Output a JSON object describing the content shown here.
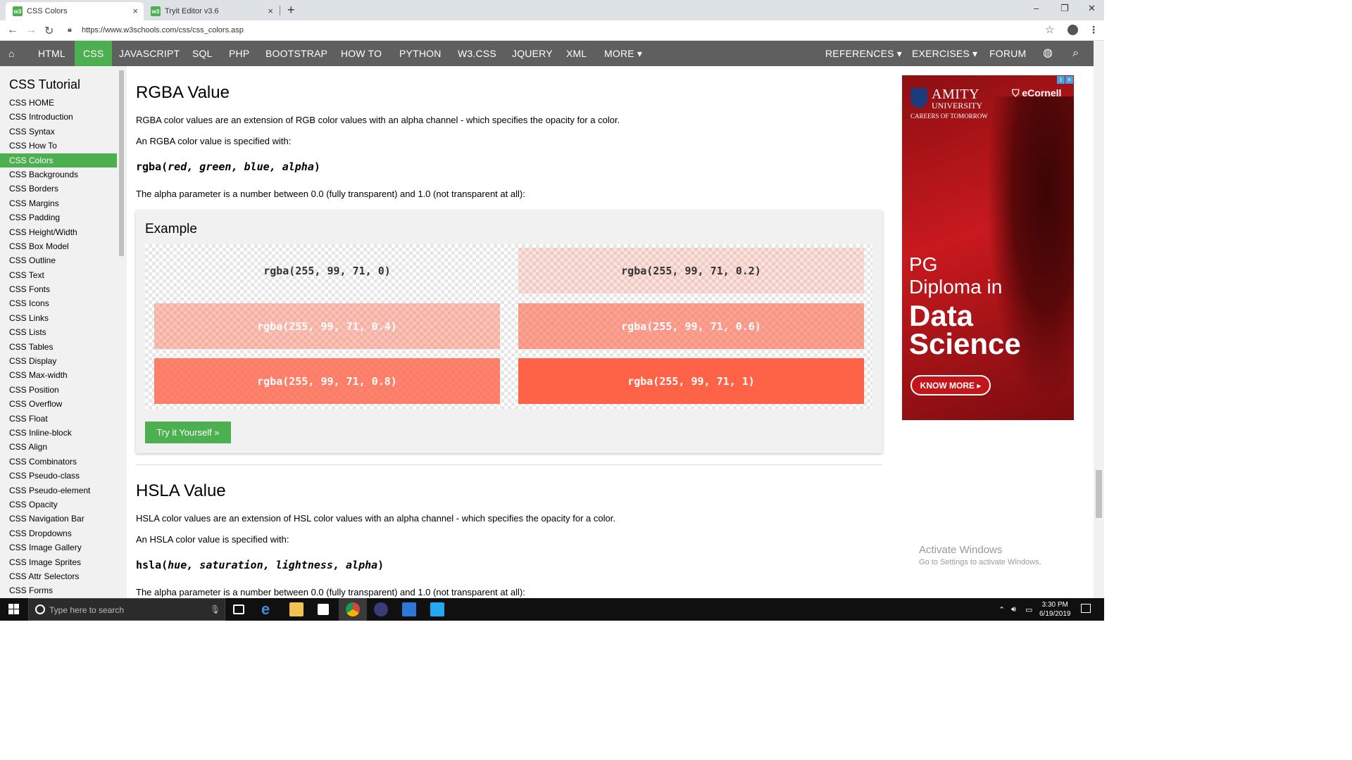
{
  "browser": {
    "tabs": [
      {
        "title": "CSS Colors",
        "active": true
      },
      {
        "title": "Tryit Editor v3.6",
        "active": false
      }
    ],
    "new_tab": "+",
    "url": "https://www.w3schools.com/css/css_colors.asp",
    "window_controls": {
      "minimize": "–",
      "maximize": "❐",
      "close": "✕"
    }
  },
  "topnav": {
    "items": [
      "HTML",
      "CSS",
      "JAVASCRIPT",
      "SQL",
      "PHP",
      "BOOTSTRAP",
      "HOW TO",
      "PYTHON",
      "W3.CSS",
      "JQUERY",
      "XML",
      "MORE ▾"
    ],
    "active": "CSS",
    "right_items": [
      "REFERENCES ▾",
      "EXERCISES ▾",
      "FORUM"
    ]
  },
  "sidebar": {
    "title": "CSS Tutorial",
    "items": [
      "CSS HOME",
      "CSS Introduction",
      "CSS Syntax",
      "CSS How To",
      "CSS Colors",
      "CSS Backgrounds",
      "CSS Borders",
      "CSS Margins",
      "CSS Padding",
      "CSS Height/Width",
      "CSS Box Model",
      "CSS Outline",
      "CSS Text",
      "CSS Fonts",
      "CSS Icons",
      "CSS Links",
      "CSS Lists",
      "CSS Tables",
      "CSS Display",
      "CSS Max-width",
      "CSS Position",
      "CSS Overflow",
      "CSS Float",
      "CSS Inline-block",
      "CSS Align",
      "CSS Combinators",
      "CSS Pseudo-class",
      "CSS Pseudo-element",
      "CSS Opacity",
      "CSS Navigation Bar",
      "CSS Dropdowns",
      "CSS Image Gallery",
      "CSS Image Sprites",
      "CSS Attr Selectors",
      "CSS Forms"
    ],
    "active": "CSS Colors"
  },
  "rgba": {
    "heading": "RGBA Value",
    "intro": "RGBA color values are an extension of RGB color values with an alpha channel - which specifies the opacity for a color.",
    "specified": "An RGBA color value is specified with:",
    "syntax_fn": "rgba(",
    "syntax_args": "red, green, blue, alpha",
    "syntax_end": ")",
    "alpha_note": "The alpha parameter is a number between 0.0 (fully transparent) and 1.0 (not transparent at all):"
  },
  "example": {
    "title": "Example",
    "swatches": [
      {
        "label": "rgba(255, 99, 71, 0)",
        "alpha": 0
      },
      {
        "label": "rgba(255, 99, 71, 0.2)",
        "alpha": 0.2
      },
      {
        "label": "rgba(255, 99, 71, 0.4)",
        "alpha": 0.4
      },
      {
        "label": "rgba(255, 99, 71, 0.6)",
        "alpha": 0.6
      },
      {
        "label": "rgba(255, 99, 71, 0.8)",
        "alpha": 0.8
      },
      {
        "label": "rgba(255, 99, 71, 1)",
        "alpha": 1
      }
    ],
    "button": "Try it Yourself »"
  },
  "hsla": {
    "heading": "HSLA Value",
    "intro": "HSLA color values are an extension of HSL color values with an alpha channel - which specifies the opacity for a color.",
    "specified": "An HSLA color value is specified with:",
    "syntax_fn": "hsla(",
    "syntax_args": "hue, saturation, lightness, alpha",
    "syntax_end": ")",
    "alpha_note": "The alpha parameter is a number between 0.0 (fully transparent) and 1.0 (not transparent at all):"
  },
  "ad": {
    "brand1": "AMITY",
    "brand2": "UNIVERSITY",
    "tagline": "CAREERS OF TOMORROW",
    "partner": "eCornell",
    "line1": "PG",
    "line2": "Diploma in",
    "line3": "Data",
    "line4": "Science",
    "cta": "KNOW MORE ▸"
  },
  "watermark": {
    "title": "Activate Windows",
    "subtitle": "Go to Settings to activate Windows."
  },
  "taskbar": {
    "search_placeholder": "Type here to search",
    "time": "3:30 PM",
    "date": "6/19/2019"
  },
  "colors": {
    "w3_green": "#4caf50",
    "nav_gray": "#5f5f5f",
    "tomato": "#ff6347"
  }
}
